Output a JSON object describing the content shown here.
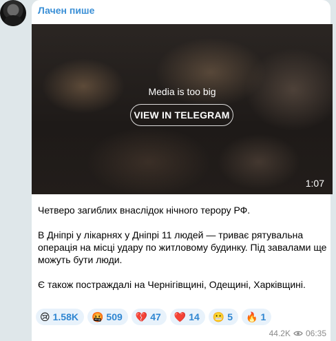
{
  "channel": {
    "name": "Лачен пише"
  },
  "video": {
    "notice": "Media is too big",
    "view_button": "VIEW IN TELEGRAM",
    "duration": "1:07"
  },
  "message": {
    "paragraphs": [
      "Четверо загиблих внаслідок нічного терору РФ.",
      "В Дніпрі у лікарнях у Дніпрі 11 людей — триває рятувальна операція на місці удару по житловому будинку. Під завалами ще можуть бути люди.",
      "Є також постраждалі на Чернігівщині, Одещині, Харківщині."
    ]
  },
  "reactions": [
    {
      "icon": "crying-face-emoji",
      "emoji": "😢",
      "count": "1.58K"
    },
    {
      "icon": "angry-face-emoji",
      "emoji": "🤬",
      "count": "509"
    },
    {
      "icon": "broken-heart-emoji",
      "emoji": "💔",
      "count": "47"
    },
    {
      "icon": "red-heart-emoji",
      "emoji": "❤️",
      "count": "14"
    },
    {
      "icon": "grimacing-face-emoji",
      "emoji": "😬",
      "count": "5"
    },
    {
      "icon": "fire-emoji",
      "emoji": "🔥",
      "count": "1"
    }
  ],
  "meta": {
    "views": "44.2K",
    "time": "06:35"
  },
  "colors": {
    "accent": "#3a8fd6",
    "background": "#dfe7ea"
  }
}
